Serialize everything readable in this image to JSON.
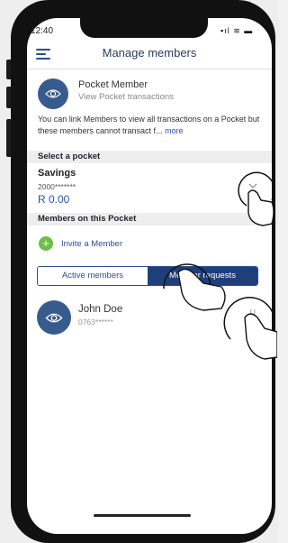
{
  "status_bar": {
    "time": "12:40",
    "icons": "▪ıl ≋ ▬"
  },
  "header": {
    "title": "Manage members"
  },
  "pocket_member": {
    "title": "Pocket Member",
    "subtitle": "View Pocket transactions",
    "description": "You can link Members to view all transactions on a Pocket but these members cannot transact f...",
    "more_link": "more"
  },
  "select_pocket": {
    "heading": "Select a pocket",
    "pocket_name": "Savings",
    "account_number": "2000*******",
    "balance": "R 0.00"
  },
  "members_section": {
    "heading": "Members on this Pocket",
    "invite_label": "Invite a Member",
    "tabs": [
      {
        "label": "Active members",
        "selected": true
      },
      {
        "label": "Member requests",
        "selected": false
      }
    ]
  },
  "members": [
    {
      "name": "John Doe",
      "phone": "0763******"
    }
  ],
  "colors": {
    "accent": "#2b4f8f",
    "avatar": "#385b8e",
    "invite_green": "#6dbd4b",
    "balance_blue": "#2b55a8"
  },
  "icons": [
    "menu-icon",
    "eye-icon",
    "chevron-down-icon",
    "plus-icon",
    "vertical-dots-icon",
    "tap-gesture-icon"
  ]
}
